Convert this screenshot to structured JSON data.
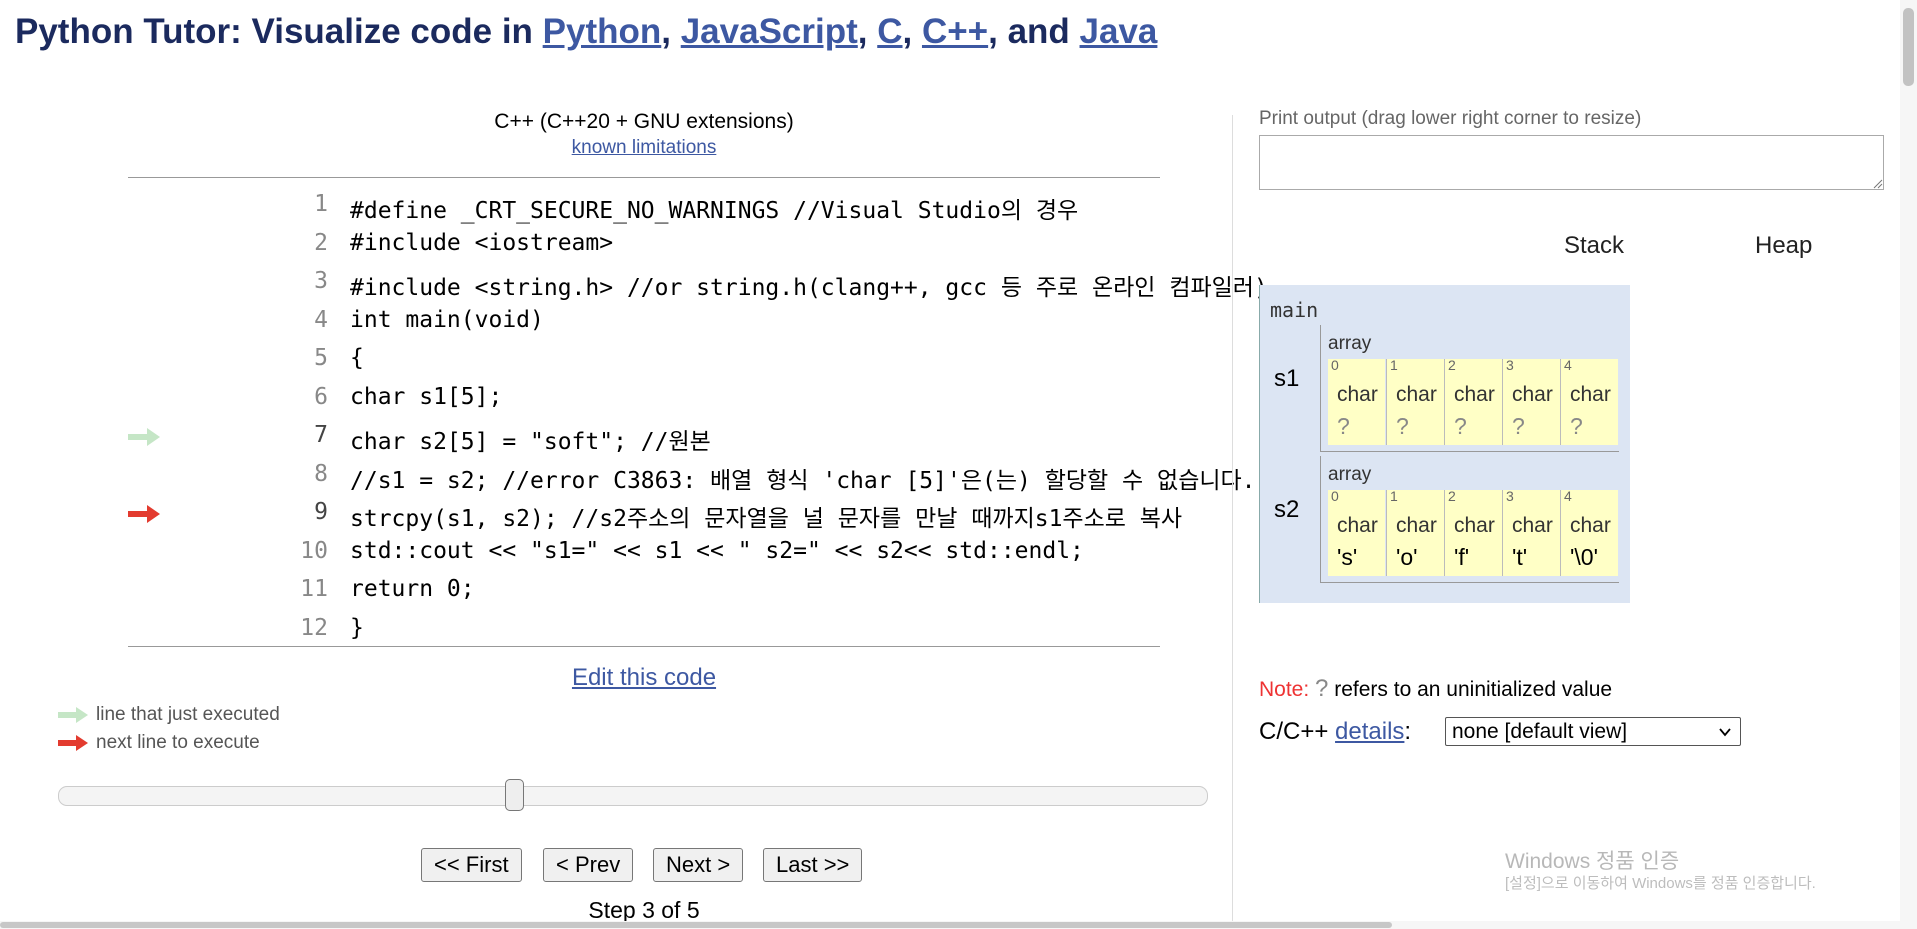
{
  "header": {
    "prefix": "Python Tutor: Visualize code in ",
    "langs": [
      "Python",
      "JavaScript",
      "C",
      "C++",
      "Java"
    ],
    "sep1": ", ",
    "sep2": ", ",
    "sep3": ", ",
    "sep4": ", and "
  },
  "editor": {
    "language": "C++ (C++20 + GNU extensions)",
    "limitations_link": "known limitations",
    "lines": [
      {
        "num": "1",
        "text": "#define _CRT_SECURE_NO_WARNINGS //Visual Studio의 경우"
      },
      {
        "num": "2",
        "text": "#include <iostream>"
      },
      {
        "num": "3",
        "text": "#include <string.h> //or string.h(clang++, gcc 등 주로 온라인 컴파일러)"
      },
      {
        "num": "4",
        "text": "int main(void)"
      },
      {
        "num": "5",
        "text": "{"
      },
      {
        "num": "6",
        "text": "char s1[5];"
      },
      {
        "num": "7",
        "text": "char s2[5] = \"soft\"; //원본"
      },
      {
        "num": "8",
        "text": "//s1 = s2; //error C3863: 배열 형식 'char [5]'은(는) 할당할 수 없습니다."
      },
      {
        "num": "9",
        "text": "strcpy(s1, s2); //s2주소의 문자열을 널 문자를 만날 때까지s1주소로 복사"
      },
      {
        "num": "10",
        "text": "std::cout << \"s1=\" << s1 << \" s2=\" << s2<< std::endl;"
      },
      {
        "num": "11",
        "text": "return 0;"
      },
      {
        "num": "12",
        "text": "}"
      }
    ],
    "just_executed_line": 7,
    "next_line": 9,
    "edit_link": "Edit this code"
  },
  "legend": {
    "executed": "line that just executed",
    "next": "next line to execute"
  },
  "navigation": {
    "first": "<< First",
    "prev": "< Prev",
    "next": "Next >",
    "last": "Last >>",
    "step_text": "Step 3 of 5",
    "current_step": 3,
    "total_steps": 5
  },
  "output": {
    "label": "Print output (drag lower right corner to resize)",
    "value": ""
  },
  "viz": {
    "stack_label": "Stack",
    "heap_label": "Heap",
    "frame_name": "main",
    "vars": [
      {
        "name": "s1",
        "kind": "array",
        "cells": [
          {
            "idx": "0",
            "type": "char",
            "value": "?"
          },
          {
            "idx": "1",
            "type": "char",
            "value": "?"
          },
          {
            "idx": "2",
            "type": "char",
            "value": "?"
          },
          {
            "idx": "3",
            "type": "char",
            "value": "?"
          },
          {
            "idx": "4",
            "type": "char",
            "value": "?"
          }
        ]
      },
      {
        "name": "s2",
        "kind": "array",
        "cells": [
          {
            "idx": "0",
            "type": "char",
            "value": "'s'"
          },
          {
            "idx": "1",
            "type": "char",
            "value": "'o'"
          },
          {
            "idx": "2",
            "type": "char",
            "value": "'f'"
          },
          {
            "idx": "3",
            "type": "char",
            "value": "'t'"
          },
          {
            "idx": "4",
            "type": "char",
            "value": "'\\0'"
          }
        ]
      }
    ]
  },
  "note": {
    "label": "Note:",
    "symbol": "?",
    "text": "refers to an uninitialized value"
  },
  "details": {
    "prefix": "C/C++",
    "link": "details",
    "colon": ":",
    "selected": "none [default view]"
  },
  "watermark": {
    "line1": "Windows 정품 인증",
    "line2": "[설정]으로 이동하여 Windows를 정품 인증합니다."
  },
  "colors": {
    "executed_arrow": "#c5e6c6",
    "next_arrow": "#e33b2f",
    "frame_bg": "#dce5f3",
    "cell_bg": "#ffffc6",
    "link": "#3d58a2"
  }
}
